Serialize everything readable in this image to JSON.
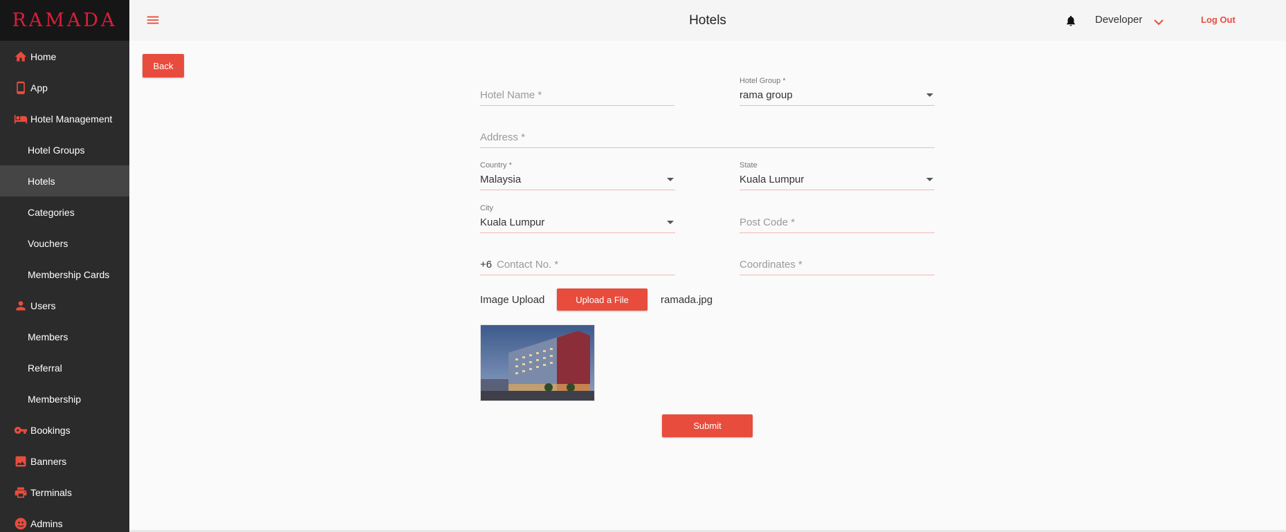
{
  "brand": {
    "logo_text": "RAMADA",
    "color": "#d81f3c"
  },
  "accent_color": "#e84c3d",
  "header": {
    "title": "Hotels",
    "user": "Developer",
    "logout": "Log Out",
    "icons": [
      "menu-icon",
      "bell-icon",
      "chevron-down-icon"
    ]
  },
  "sidebar": {
    "items": [
      {
        "label": "Home",
        "icon": "home-icon"
      },
      {
        "label": "App",
        "icon": "phone-icon"
      },
      {
        "label": "Hotel Management",
        "icon": "hotel-icon"
      },
      {
        "label": "Hotel Groups"
      },
      {
        "label": "Hotels",
        "active": true
      },
      {
        "label": "Categories"
      },
      {
        "label": "Vouchers"
      },
      {
        "label": "Membership Cards"
      },
      {
        "label": "Users",
        "icon": "person-icon"
      },
      {
        "label": "Members"
      },
      {
        "label": "Referral"
      },
      {
        "label": "Membership"
      },
      {
        "label": "Bookings",
        "icon": "key-icon"
      },
      {
        "label": "Banners",
        "icon": "image-icon"
      },
      {
        "label": "Terminals",
        "icon": "printer-icon"
      },
      {
        "label": "Admins",
        "icon": "admin-icon"
      }
    ]
  },
  "actions": {
    "back": "Back",
    "submit": "Submit"
  },
  "form": {
    "hotel_name": {
      "placeholder": "Hotel Name *",
      "value": ""
    },
    "hotel_group": {
      "label": "Hotel Group *",
      "value": "rama group"
    },
    "address": {
      "placeholder": "Address *",
      "value": ""
    },
    "country": {
      "label": "Country *",
      "value": "Malaysia"
    },
    "state": {
      "label": "State",
      "value": "Kuala Lumpur"
    },
    "city": {
      "label": "City",
      "value": "Kuala Lumpur"
    },
    "post_code": {
      "placeholder": "Post Code *",
      "value": ""
    },
    "contact": {
      "prefix": "+6",
      "placeholder": "Contact No. *",
      "value": ""
    },
    "coordinates": {
      "placeholder": "Coordinates *",
      "value": ""
    },
    "image_upload": {
      "label": "Image Upload",
      "button": "Upload a File",
      "filename": "ramada.jpg"
    }
  }
}
